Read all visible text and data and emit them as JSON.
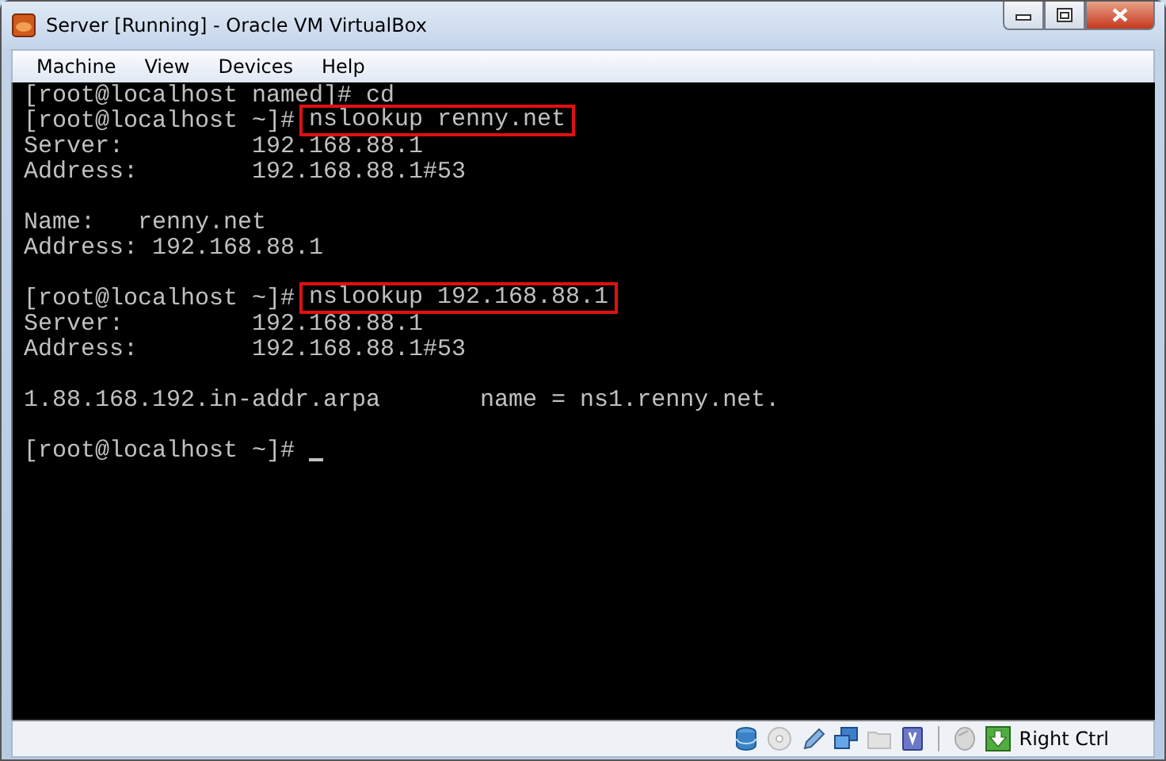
{
  "window": {
    "title": "Server [Running] - Oracle VM VirtualBox"
  },
  "menu": [
    "Machine",
    "View",
    "Devices",
    "Help"
  ],
  "terminal": {
    "lines": [
      {
        "kind": "command",
        "prompt": "[root@localhost named]#",
        "command": "cd",
        "highlighted": false
      },
      {
        "kind": "command",
        "prompt": "[root@localhost ~]#",
        "command": "nslookup renny.net",
        "highlighted": true
      },
      {
        "kind": "output",
        "text": "Server:\t\t192.168.88.1"
      },
      {
        "kind": "output",
        "text": "Address:\t192.168.88.1#53"
      },
      {
        "kind": "blank"
      },
      {
        "kind": "output",
        "text": "Name:\trenny.net"
      },
      {
        "kind": "output",
        "text": "Address: 192.168.88.1"
      },
      {
        "kind": "blank"
      },
      {
        "kind": "command",
        "prompt": "[root@localhost ~]#",
        "command": "nslookup 192.168.88.1",
        "highlighted": true
      },
      {
        "kind": "output",
        "text": "Server:\t\t192.168.88.1"
      },
      {
        "kind": "output",
        "text": "Address:\t192.168.88.1#53"
      },
      {
        "kind": "blank"
      },
      {
        "kind": "output",
        "text": "1.88.168.192.in-addr.arpa\tname = ns1.renny.net."
      },
      {
        "kind": "blank"
      },
      {
        "kind": "prompt",
        "prompt": "[root@localhost ~]#",
        "cursor": true
      }
    ]
  },
  "status_bar": {
    "host_key": "Right Ctrl"
  }
}
